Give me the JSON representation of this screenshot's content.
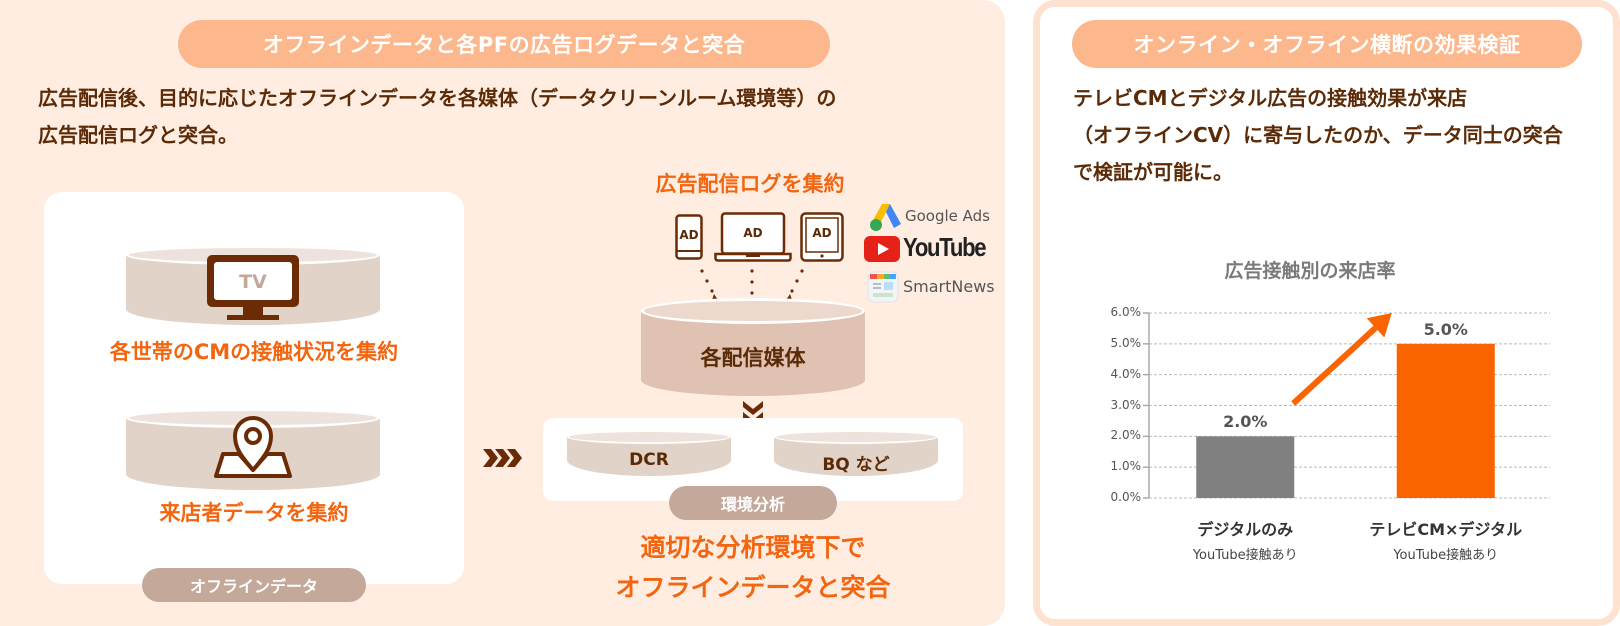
{
  "left_panel": {
    "header": "オフラインデータと各PFの広告ログデータと突合",
    "lead_lines": [
      "広告配信後、目的に応じたオフラインデータを各媒体（データクリーンルーム環境等）の",
      "広告配信ログと突合。"
    ],
    "offline_box": {
      "items": [
        {
          "icon": "tv-icon",
          "icon_text": "TV",
          "caption": "各世帯のCMの接触状況を集約"
        },
        {
          "icon": "map-pin-icon",
          "caption": "来店者データを集約"
        }
      ],
      "tag": "オフラインデータ"
    },
    "ad_logs": {
      "caption": "広告配信ログを集約",
      "devices": [
        {
          "icon": "smartphone-icon",
          "text": "AD"
        },
        {
          "icon": "laptop-icon",
          "text": "AD"
        },
        {
          "icon": "tablet-icon",
          "text": "AD"
        }
      ],
      "platforms": [
        {
          "icon": "google-ads-icon",
          "name": "Google Ads"
        },
        {
          "icon": "youtube-icon",
          "name": "YouTube"
        },
        {
          "icon": "smartnews-icon",
          "name": "SmartNews"
        }
      ],
      "media_cylinder": "各配信媒体"
    },
    "analysis_env": {
      "items": [
        "DCR",
        "BQ など"
      ],
      "tag": "環境分析"
    },
    "conclusion_lines": [
      "適切な分析環境下で",
      "オフラインデータと突合"
    ]
  },
  "right_panel": {
    "header": "オンライン・オフライン横断の効果検証",
    "lead_lines": [
      "テレビCMとデジタル広告の接触効果が来店",
      "（オフラインCV）に寄与したのか、データ同士の突合",
      "で検証が可能に。"
    ]
  },
  "colors": {
    "accent_orange": "#f4650f",
    "header_pill": "#fdb78d",
    "dark_brown": "#5b2a06",
    "panel_bg": "#ffede2",
    "bar_gray": "#808080",
    "bar_orange": "#f96400"
  },
  "chart_data": {
    "type": "bar",
    "title": "広告接触別の来店率",
    "categories": [
      "デジタルのみ",
      "テレビCM×デジタル"
    ],
    "category_sublabels": [
      "YouTube接触あり",
      "YouTube接触あり"
    ],
    "values": [
      2.0,
      5.0
    ],
    "value_labels": [
      "2.0%",
      "5.0%"
    ],
    "bar_colors": [
      "#808080",
      "#f96400"
    ],
    "xlabel": "",
    "ylabel": "",
    "ylim": [
      0,
      6
    ],
    "yticks": [
      "0.0%",
      "1.0%",
      "2.0%",
      "3.0%",
      "4.0%",
      "5.0%",
      "6.0%"
    ],
    "grid": true,
    "annotation": "upward-arrow"
  }
}
